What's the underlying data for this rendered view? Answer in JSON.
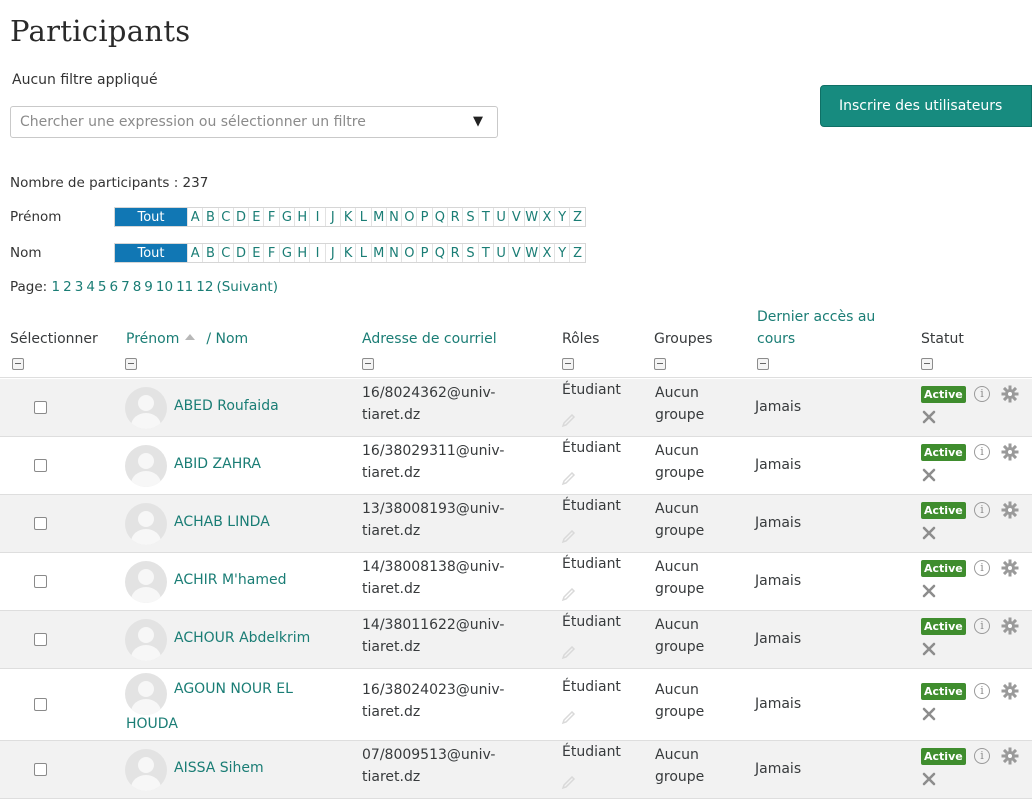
{
  "page": {
    "title": "Participants",
    "filter_label": "Aucun filtre appliqué",
    "filter_placeholder": "Chercher une expression ou sélectionner un filtre",
    "enrol_button": "Inscrire des utilisateurs",
    "count_text": "Nombre de participants : 237"
  },
  "initials": {
    "firstname_label": "Prénom",
    "lastname_label": "Nom",
    "all_label": "Tout",
    "letters": [
      "A",
      "B",
      "C",
      "D",
      "E",
      "F",
      "G",
      "H",
      "I",
      "J",
      "K",
      "L",
      "M",
      "N",
      "O",
      "P",
      "Q",
      "R",
      "S",
      "T",
      "U",
      "V",
      "W",
      "X",
      "Y",
      "Z"
    ]
  },
  "pager": {
    "label": "Page:",
    "pages": [
      "1",
      "2",
      "3",
      "4",
      "5",
      "6",
      "7",
      "8",
      "9",
      "10",
      "11",
      "12"
    ],
    "next": "(Suivant)"
  },
  "table": {
    "headers": {
      "select": "Sélectionner",
      "firstname": "Prénom",
      "lastname": "/ Nom",
      "email": "Adresse de courriel",
      "roles": "Rôles",
      "groups": "Groupes",
      "lastaccess_1": "Dernier accès au",
      "lastaccess_2": "cours",
      "status": "Statut"
    },
    "status_badge": "Active",
    "rows": [
      {
        "name": "ABED Roufaida",
        "email_1": "16/8024362@univ-",
        "email_2": "tiaret.dz",
        "role": "Étudiant",
        "group_1": "Aucun",
        "group_2": "groupe",
        "access": "Jamais"
      },
      {
        "name": "ABID ZAHRA",
        "email_1": "16/38029311@univ-",
        "email_2": "tiaret.dz",
        "role": "Étudiant",
        "group_1": "Aucun",
        "group_2": "groupe",
        "access": "Jamais"
      },
      {
        "name": "ACHAB LINDA",
        "email_1": "13/38008193@univ-",
        "email_2": "tiaret.dz",
        "role": "Étudiant",
        "group_1": "Aucun",
        "group_2": "groupe",
        "access": "Jamais"
      },
      {
        "name": "ACHIR M'hamed",
        "email_1": "14/38008138@univ-",
        "email_2": "tiaret.dz",
        "role": "Étudiant",
        "group_1": "Aucun",
        "group_2": "groupe",
        "access": "Jamais"
      },
      {
        "name": "ACHOUR Abdelkrim",
        "email_1": "14/38011622@univ-",
        "email_2": "tiaret.dz",
        "role": "Étudiant",
        "group_1": "Aucun",
        "group_2": "groupe",
        "access": "Jamais"
      },
      {
        "name_1": "AGOUN NOUR EL",
        "name_2": "HOUDA",
        "email_1": "16/38024023@univ-",
        "email_2": "tiaret.dz",
        "role": "Étudiant",
        "group_1": "Aucun",
        "group_2": "groupe",
        "access": "Jamais"
      },
      {
        "name": "AISSA Sihem",
        "email_1": "07/8009513@univ-",
        "email_2": "tiaret.dz",
        "role": "Étudiant",
        "group_1": "Aucun",
        "group_2": "groupe",
        "access": "Jamais"
      }
    ]
  },
  "icons": {
    "filter_arrow": "dropdown-arrow-icon",
    "sort": "sort-caret-icon",
    "collapse": "collapse-column-icon",
    "edit": "pencil-icon",
    "info": "info-icon",
    "settings": "gear-icon",
    "unenrol": "close-icon"
  },
  "colors": {
    "link": "#1a7d75",
    "primary_button": "#178b7f",
    "initial_selected": "#1177b4",
    "badge_active": "#3f8d2e"
  }
}
